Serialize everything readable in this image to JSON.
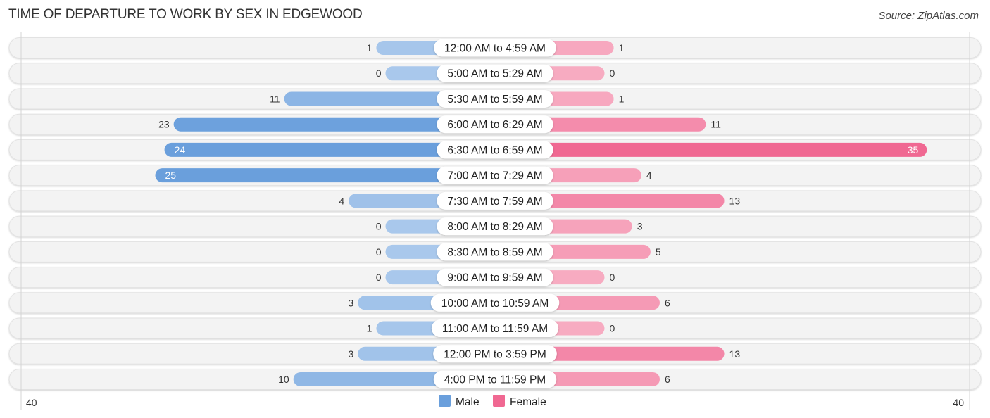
{
  "header": {
    "title": "TIME OF DEPARTURE TO WORK BY SEX IN EDGEWOOD",
    "source": "Source: ZipAtlas.com"
  },
  "chart_data": {
    "type": "bar",
    "orientation": "horizontal-diverging",
    "title": "TIME OF DEPARTURE TO WORK BY SEX IN EDGEWOOD",
    "categories": [
      "12:00 AM to 4:59 AM",
      "5:00 AM to 5:29 AM",
      "5:30 AM to 5:59 AM",
      "6:00 AM to 6:29 AM",
      "6:30 AM to 6:59 AM",
      "7:00 AM to 7:29 AM",
      "7:30 AM to 7:59 AM",
      "8:00 AM to 8:29 AM",
      "8:30 AM to 8:59 AM",
      "9:00 AM to 9:59 AM",
      "10:00 AM to 10:59 AM",
      "11:00 AM to 11:59 AM",
      "12:00 PM to 3:59 PM",
      "4:00 PM to 11:59 PM"
    ],
    "series": [
      {
        "name": "Male",
        "side": "left",
        "color": "#6a9fdc",
        "light_color": "#a9c8ec",
        "values": [
          1,
          0,
          11,
          23,
          24,
          25,
          4,
          0,
          0,
          0,
          3,
          1,
          3,
          10
        ]
      },
      {
        "name": "Female",
        "side": "right",
        "color": "#f06892",
        "light_color": "#f7abc1",
        "values": [
          1,
          0,
          1,
          11,
          35,
          4,
          13,
          3,
          5,
          0,
          6,
          0,
          13,
          6
        ]
      }
    ],
    "xlim": [
      40,
      40
    ],
    "axis_tick_labels": {
      "left": "40",
      "right": "40"
    },
    "xlabel": "",
    "ylabel": "",
    "grid": false,
    "legend": {
      "entries": [
        "Male",
        "Female"
      ],
      "placement": "bottom-center"
    }
  }
}
